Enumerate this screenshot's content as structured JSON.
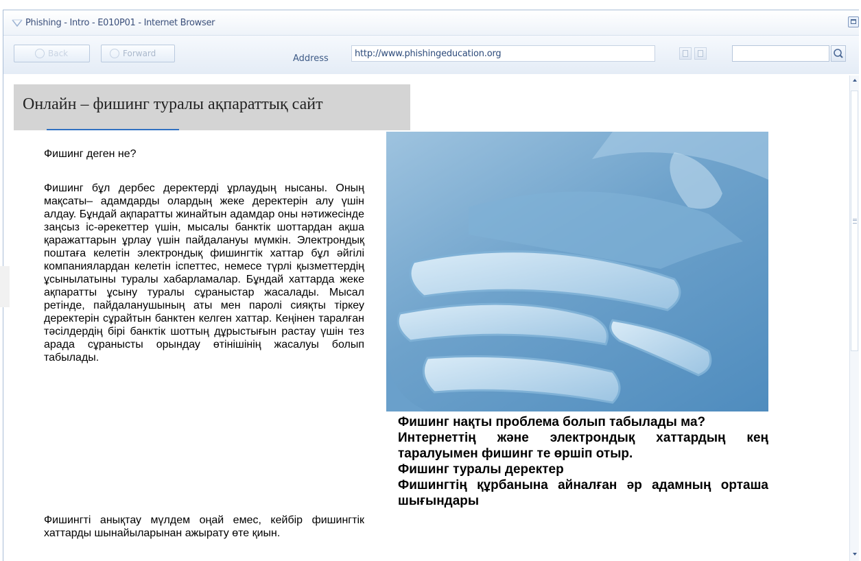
{
  "window": {
    "title": "Phishing - Intro - E010P01 - Internet Browser"
  },
  "toolbar": {
    "back_label": "Back",
    "forward_label": "Forward",
    "address_label": "Address",
    "address_value": "http://www.phishingeducation.org",
    "search_value": ""
  },
  "page": {
    "header": "Онлайн – фишинг туралы ақпараттық сайт",
    "question": "Фишинг деген не?",
    "paragraph1": "Фишинг бұл дербес деректерді ұрлаудың нысаны. Оның мақсаты– адамдарды олардың жеке деректерін алу үшін алдау. Бұндай ақпаратты жинайтын адамдар оны нәтижесінде заңсыз іс-әрекеттер үшін, мысалы банктік шоттардан ақша қаражаттарын ұрлау үшін пайдалануы мүмкін. Электрондық поштаға келетін электрондық фишингтік хаттар бұл әйгілі компаниялардан келетін іспеттес, немесе түрлі қызметтердің ұсынылатыны туралы хабарламалар. Бұндай хаттарда жеке ақпаратты ұсыну туралы сұраныстар жасалады. Мысал ретінде, пайдаланушының аты мен паролі сияқты тіркеу деректерін сұрайтын банктен келген хаттар. Кеңінен таралған тәсілдердің бірі банктік шоттың дұрыстығын растау үшін тез арада сұранысты орындау өтінішінің жасалуы болып табылады.",
    "paragraph2": "Фишингті анықтау мүлдем оңай емес, кейбір фишингтік хаттарды шынайыларынан ажырату өте қиын.",
    "right_line1": "Фишинг нақты проблема болып табылады ма?",
    "right_line2": "Интернеттің және электрондық хаттардың кең таралуымен фишинг те өршіп отыр.",
    "right_line3": "Фишинг туралы деректер",
    "right_line4": "Фишингтің құрбанына айналған әр адамның орташа шығындары"
  },
  "colors": {
    "accent": "#2f71c2",
    "header_bg": "#d4d4d4",
    "toolbar_bg": "#e4ecf6"
  }
}
